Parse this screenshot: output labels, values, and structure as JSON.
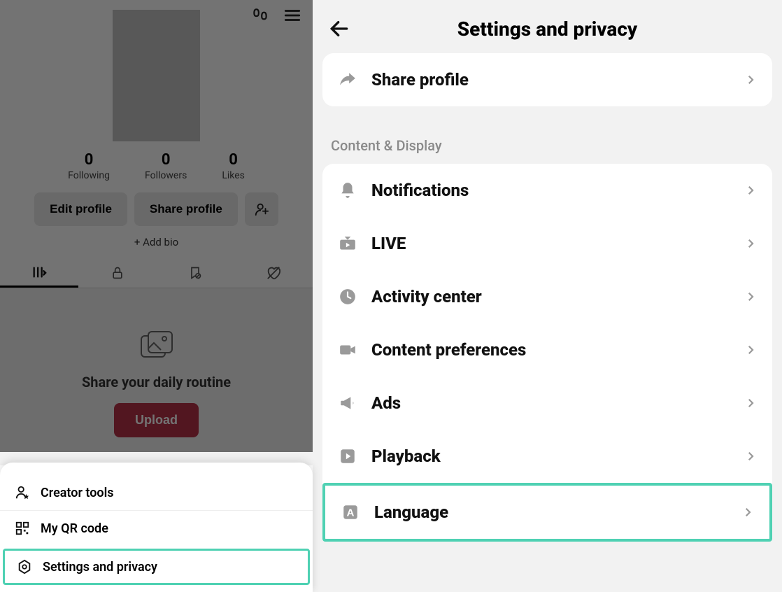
{
  "left": {
    "stats": {
      "following": {
        "count": "0",
        "label": "Following"
      },
      "followers": {
        "count": "0",
        "label": "Followers"
      },
      "likes": {
        "count": "0",
        "label": "Likes"
      }
    },
    "edit_btn": "Edit profile",
    "share_btn": "Share profile",
    "add_bio": "+ Add bio",
    "empty_text": "Share your daily routine",
    "upload_btn": "Upload",
    "drawer": {
      "creator": "Creator tools",
      "qr": "My QR code",
      "settings": "Settings and privacy"
    }
  },
  "right": {
    "title": "Settings and privacy",
    "share_profile": "Share profile",
    "section_label": "Content & Display",
    "rows": {
      "notifications": "Notifications",
      "live": "LIVE",
      "activity": "Activity center",
      "content_pref": "Content preferences",
      "ads": "Ads",
      "playback": "Playback",
      "language": "Language"
    }
  }
}
